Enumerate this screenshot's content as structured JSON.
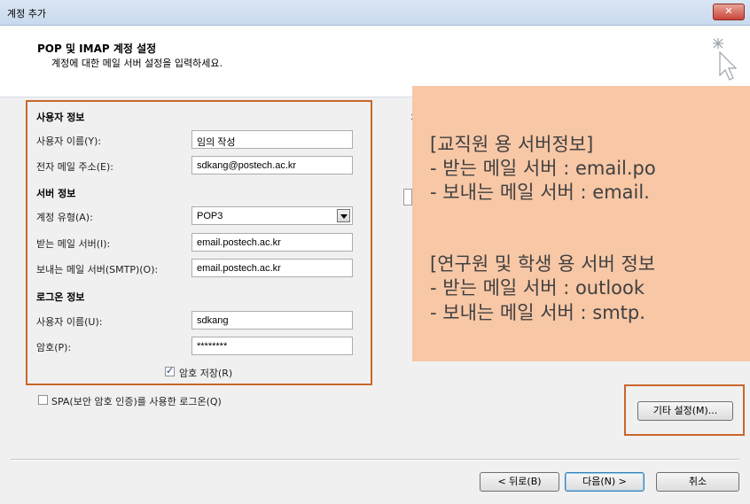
{
  "window": {
    "title": "계정 추가",
    "close_glyph": "✕"
  },
  "header": {
    "title": "POP 및 IMAP 계정 설정",
    "subtitle": "계정에 대한 메일 서버 설정을 입력하세요."
  },
  "user_info": {
    "section": "사용자 정보",
    "name_label": "사용자 이름(Y):",
    "name_value": "임의 작성",
    "email_label": "전자 메일 주소(E):",
    "email_value": "sdkang@postech.ac.kr"
  },
  "server_info": {
    "section": "서버 정보",
    "account_type_label": "계정 유형(A):",
    "account_type_value": "POP3",
    "incoming_label": "받는 메일 서버(I):",
    "incoming_value": "email.postech.ac.kr",
    "outgoing_label": "보내는 메일 서버(SMTP)(O):",
    "outgoing_value": "email.postech.ac.kr"
  },
  "logon_info": {
    "section": "로그온 정보",
    "username_label": "사용자 이름(U):",
    "username_value": "sdkang",
    "password_label": "암호(P):",
    "password_value": "********",
    "save_password_label": "암호 저장(R)",
    "save_password_checked": true
  },
  "spa": {
    "label": "SPA(보안 암호 인증)를 사용한 로그온(Q)",
    "checked": false
  },
  "note": {
    "line1": "[교직원 용 서버정보]",
    "line2": "-   받는 메일 서버 : email.po",
    "line3": "-   보내는 메일 서버 : email.",
    "line4": "[연구원 및 학생 용 서버 정보",
    "line5": "-   받는 메일 서버 : outlook",
    "line6": "-   보내는 메일 서버 : smtp."
  },
  "buttons": {
    "more_settings": "기타 설정(M)...",
    "back": "< 뒤로(B)",
    "next": "다음(N) >",
    "cancel": "취소"
  },
  "colors": {
    "highlight_border": "#c8662b",
    "note_bg": "#f7c7a6"
  }
}
